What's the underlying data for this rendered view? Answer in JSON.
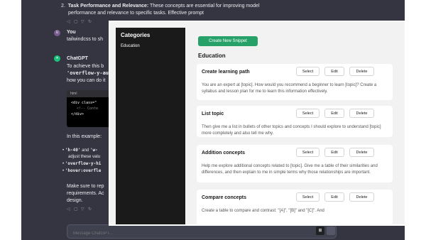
{
  "chat": {
    "item2_prefix": "2.",
    "item2_bold": "Task Performance and Relevance:",
    "item2_text": " These concepts are essential for improving model",
    "item2_line2": "performance and relevance to specific tasks. Effective prompt",
    "you_label": "You",
    "you_text": "tailwindcss to sh",
    "gpt_label": "ChatGPT",
    "gpt_line1": "To achieve this b",
    "gpt_line2": "'overflow-y-au",
    "gpt_line3": "how you can do it",
    "code_lang": "html",
    "code_line1": "<div class=\"",
    "code_line2": "<!-- Conte",
    "code_line3": "</div>",
    "in_example": "In this example:",
    "b1a": "'h-40'",
    "b1b": " and ",
    "b1c": "'w-",
    "b1_line2": "adjust these valu",
    "b2": "'overflow-y-hi",
    "b3": "'hover:overfle",
    "make_sure1": "Make sure to rep",
    "make_sure2": "requirements. Ac",
    "make_sure3": "design.",
    "input_placeholder": "Message ChatGPT..."
  },
  "modal": {
    "sidebar_title": "Categories",
    "sidebar_items": [
      "Education"
    ],
    "create_label": "Create New Snippet",
    "section_title": "Education",
    "select_label": "Select",
    "edit_label": "Edit",
    "delete_label": "Delete",
    "snippets": [
      {
        "title": "Create learning path",
        "desc": "You are an expert at [topic]. How would you recommend a beginner to learn [topic]? Create a syllabus and lesson plan for me to learn this information effectively."
      },
      {
        "title": "List topic",
        "desc": "Then give me a list in bullets of other topics and concepts I should explore to understand [topic] more completely and also tell me why."
      },
      {
        "title": "Addition concepts",
        "desc": "Help me explore additional concepts related to [topic]. Give me a table of their similarities and differences, and then explain to me in simple terms why those relationships are important."
      },
      {
        "title": "Compare concepts",
        "desc": "Create a table to compare and contrast: \"[A]\", \"[B]\" and \"[C]\". And"
      }
    ]
  }
}
